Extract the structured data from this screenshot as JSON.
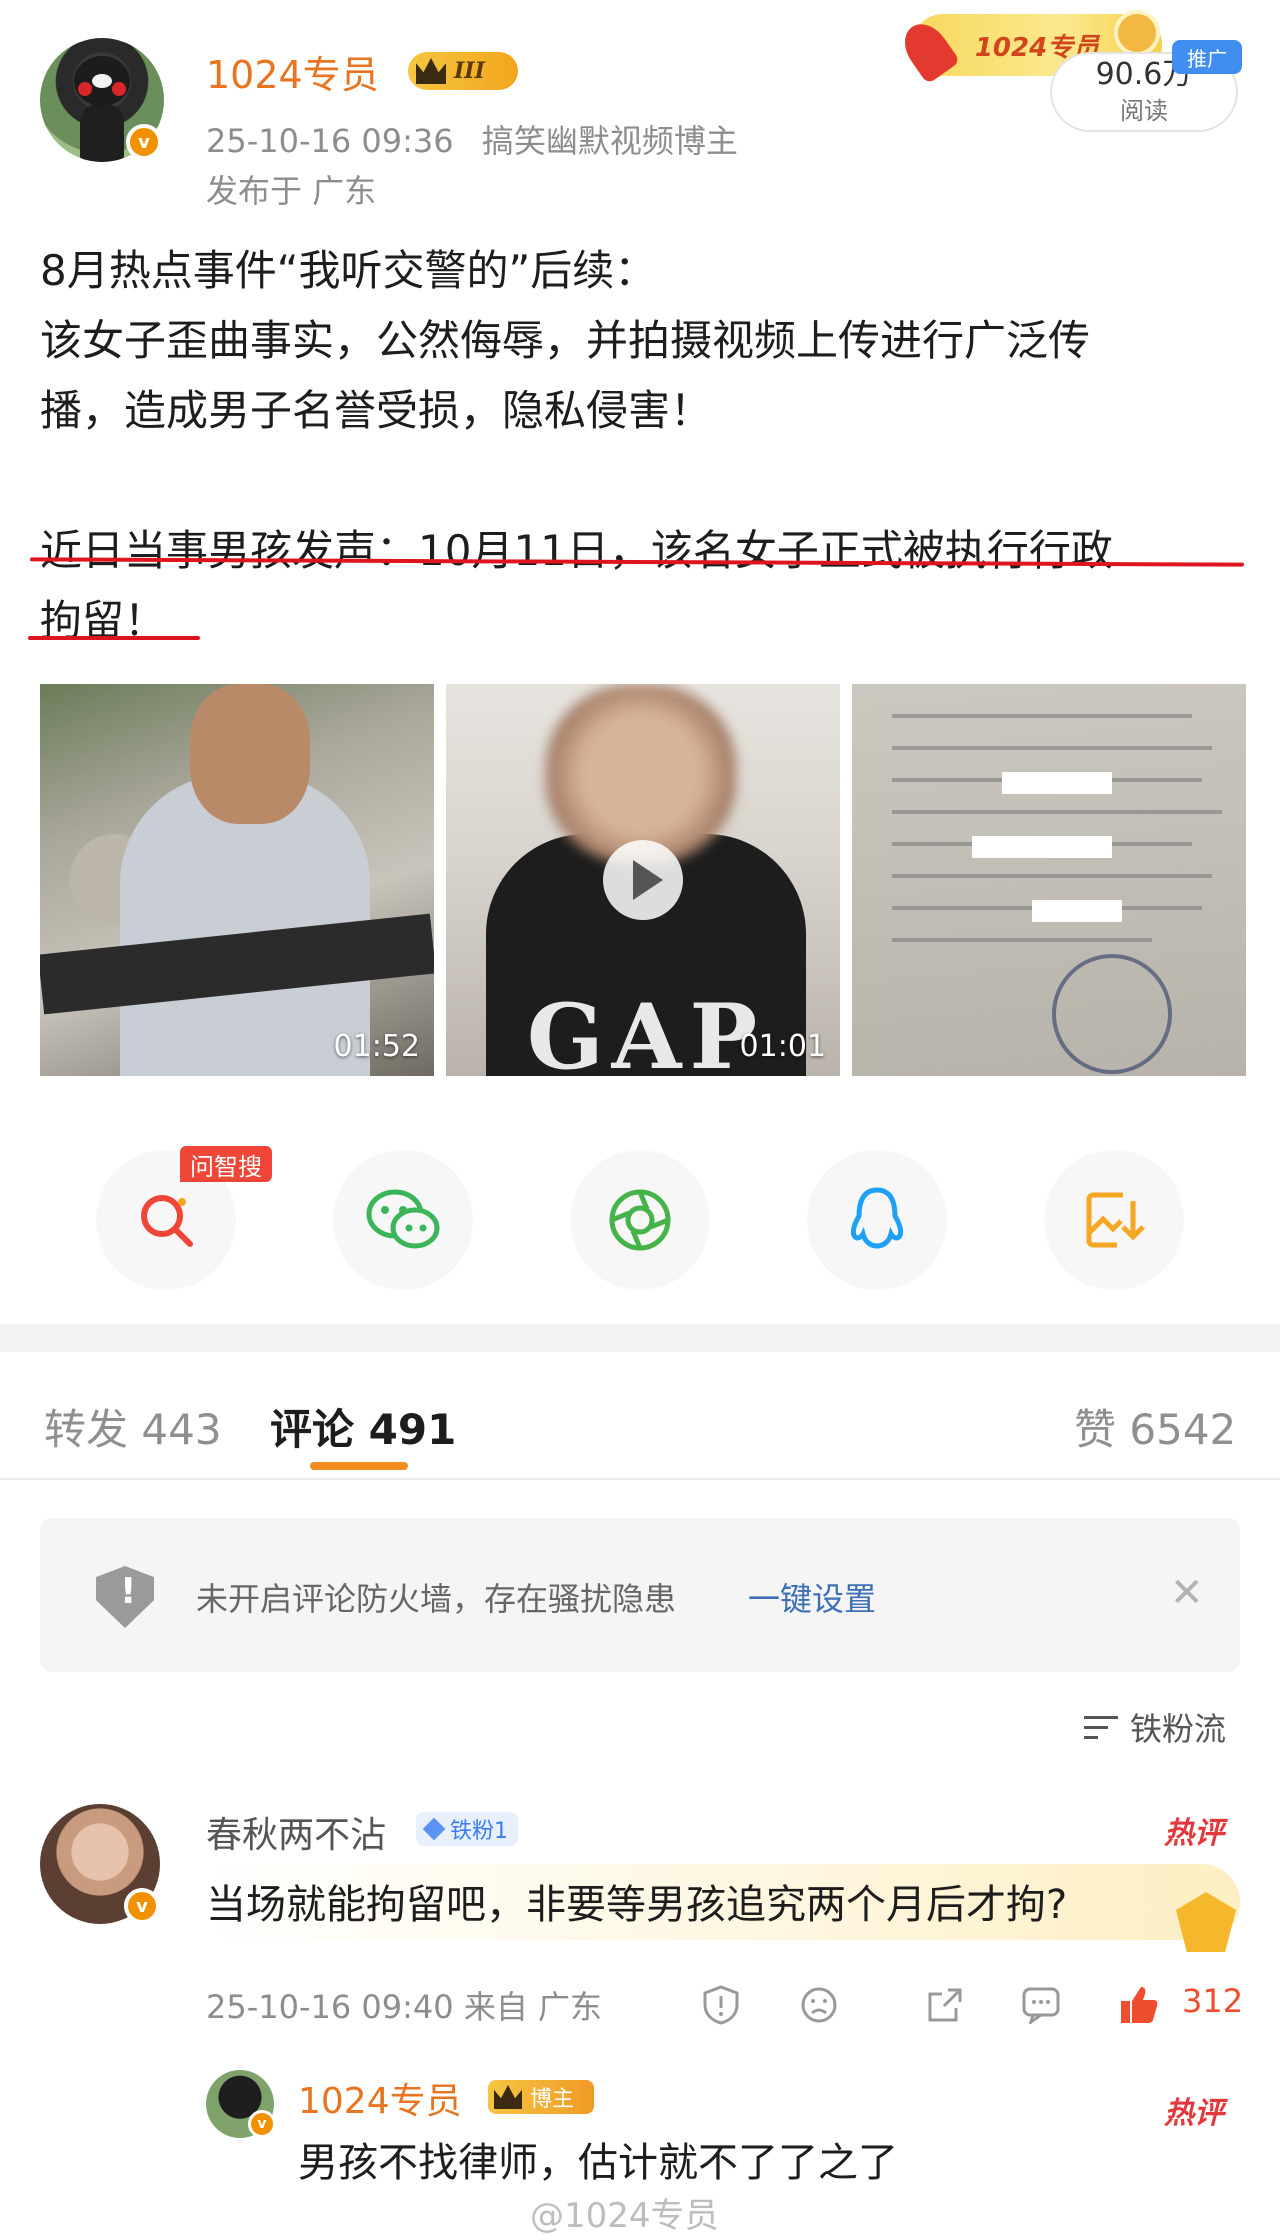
{
  "post": {
    "author": "1024专员",
    "vip_level": "III",
    "timestamp": "25-10-16 09:36",
    "author_title": "搞笑幽默视频博主",
    "location": "发布于 广东",
    "promo_banner": "1024专员",
    "read_count": "90.6万",
    "read_label": "阅读",
    "ad_tag": "推广",
    "body_lines": [
      "8月热点事件“我听交警的”后续：",
      "该女子歪曲事实，公然侮辱，并拍摄视频上传进行广泛传",
      "播，造成男子名誉受损，隐私侵害！",
      "近日当事男孩发声：10月11日，该名女子正式被执行行政",
      "拘留！"
    ],
    "media": [
      {
        "type": "video",
        "duration": "01:52"
      },
      {
        "type": "video",
        "duration": "01:01",
        "logo_text": "GAP"
      },
      {
        "type": "image"
      }
    ]
  },
  "share": {
    "ai_search_tag": "问智搜",
    "buttons": [
      "search-ai",
      "wechat",
      "moments",
      "qq",
      "save-image"
    ]
  },
  "tabs": {
    "repost_label": "转发",
    "repost_count": "443",
    "comment_label": "评论",
    "comment_count": "491",
    "like_label": "赞",
    "like_count": "6542"
  },
  "firewall": {
    "text": "未开启评论防火墙，存在骚扰隐患",
    "link": "一键设置"
  },
  "sort": {
    "label": "铁粉流"
  },
  "comment": {
    "author": "春秋两不沾",
    "fan_badge": "铁粉1",
    "hot_tag": "热评",
    "text": "当场就能拘留吧，非要等男孩追究两个月后才拘?",
    "time": "25-10-16 09:40",
    "source": "来自 广东",
    "likes": "312"
  },
  "reply": {
    "author": "1024专员",
    "badge": "博主",
    "hot_tag": "热评",
    "text": "男孩不找律师，估计就不了了之了"
  },
  "watermark": "@1024专员",
  "colors": {
    "accent_orange": "#e8741f",
    "highlight_red": "#e0141e",
    "link_blue": "#3d6fb7",
    "like_red": "#f04d2f"
  }
}
